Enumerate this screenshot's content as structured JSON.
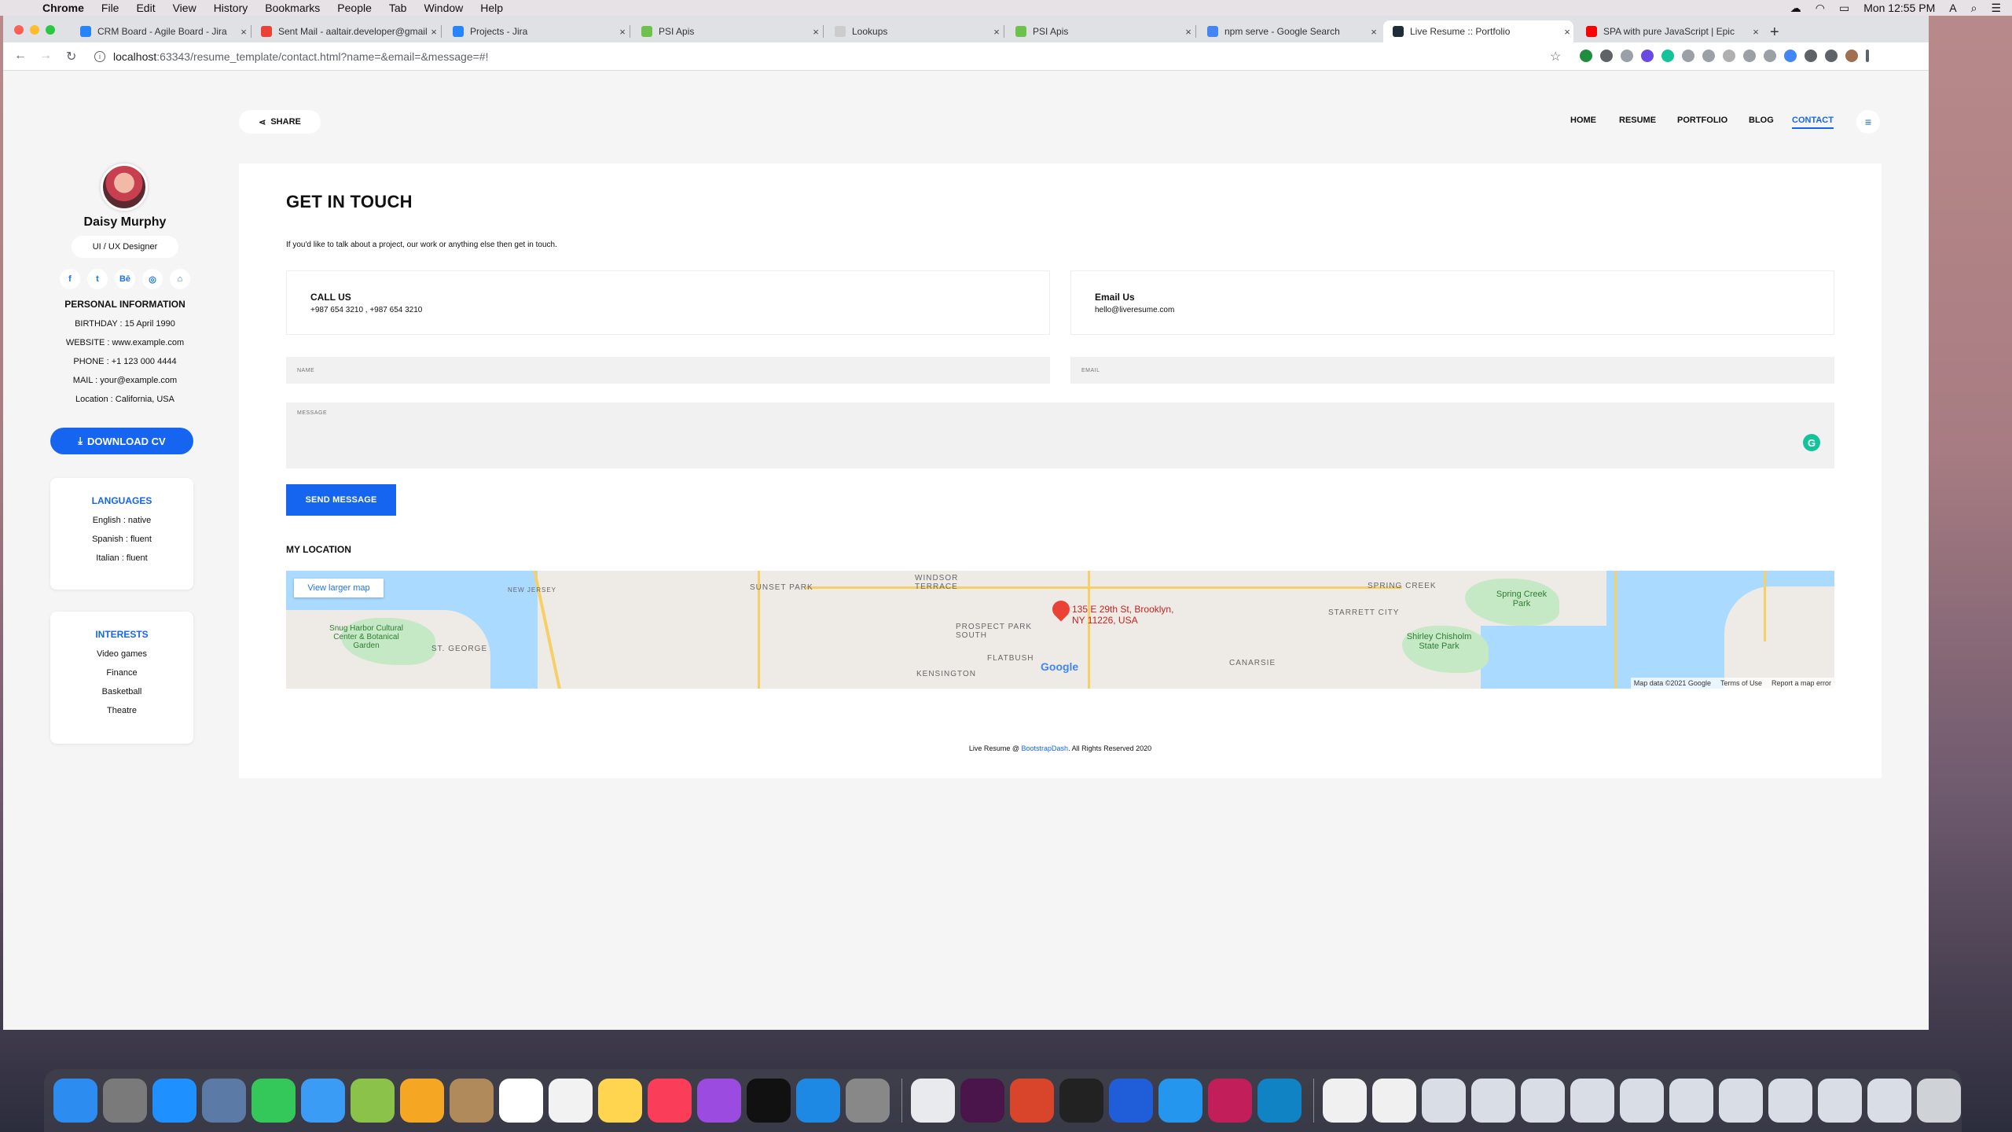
{
  "menubar": {
    "app": "Chrome",
    "items": [
      "File",
      "Edit",
      "View",
      "History",
      "Bookmarks",
      "People",
      "Tab",
      "Window",
      "Help"
    ],
    "clock": "Mon 12:55 PM"
  },
  "tabs": [
    {
      "title": "CRM Board - Agile Board - Jira",
      "color": "#2684ff"
    },
    {
      "title": "Sent Mail - aaltair.developer@gmail.com",
      "color": "#ea4335"
    },
    {
      "title": "Projects - Jira",
      "color": "#2684ff"
    },
    {
      "title": "PSI Apis",
      "color": "#6cc24a"
    },
    {
      "title": "Lookups",
      "color": "#cccccc"
    },
    {
      "title": "PSI Apis",
      "color": "#6cc24a"
    },
    {
      "title": "npm serve - Google Search",
      "color": "#4285f4"
    },
    {
      "title": "Live Resume :: Portfolio",
      "color": "#1f2d3a"
    },
    {
      "title": "SPA with pure JavaScript | Epic",
      "color": "#ff0000"
    }
  ],
  "address": {
    "host": "localhost",
    "path": ":63343/resume_template/contact.html?name=&email=&message=#!"
  },
  "profile": {
    "name": "Daisy Murphy",
    "role": "UI / UX Designer",
    "socials": [
      "f",
      "t",
      "Bē",
      "◎",
      "⌂"
    ],
    "personal_title": "PERSONAL INFORMATION",
    "personal": [
      "BIRTHDAY : 15 April 1990",
      "WEBSITE : www.example.com",
      "PHONE : +1 123 000 4444",
      "MAIL : your@example.com",
      "Location : California, USA"
    ],
    "download": "DOWNLOAD CV"
  },
  "languages": {
    "title": "LANGUAGES",
    "items": [
      "English : native",
      "Spanish : fluent",
      "Italian : fluent"
    ]
  },
  "interests": {
    "title": "INTERESTS",
    "items": [
      "Video games",
      "Finance",
      "Basketball",
      "Theatre"
    ]
  },
  "share": "SHARE",
  "nav": [
    "HOME",
    "RESUME",
    "PORTFOLIO",
    "BLOG",
    "CONTACT"
  ],
  "contact": {
    "title": "GET IN TOUCH",
    "intro": "If you'd like to talk about a project, our work or anything else then get in touch.",
    "call_title": "CALL US",
    "call_value": "+987 654 3210 , +987 654 3210",
    "email_title": "Email Us",
    "email_value": "hello@liveresume.com",
    "name_placeholder": "NAME",
    "email_placeholder": "EMAIL",
    "message_placeholder": "MESSAGE",
    "send": "SEND MESSAGE",
    "location_title": "MY LOCATION"
  },
  "map": {
    "larger": "View larger map",
    "address_line1": "135 E 29th St, Brooklyn,",
    "address_line2": "NY 11226, USA",
    "labels": [
      "SUNSET PARK",
      "NEW JERSEY",
      "ST. GEORGE",
      "Snug Harbor Cultural Center & Botanical Garden",
      "WINDSOR TERRACE",
      "PROSPECT PARK SOUTH",
      "FLATBUSH",
      "KENSINGTON",
      "SPRING CREEK",
      "STARRETT CITY",
      "Spring Creek Park",
      "Shirley Chisholm State Park",
      "CANARSIE"
    ],
    "attrib": [
      "Map data ©2021 Google",
      "Terms of Use",
      "Report a map error"
    ]
  },
  "footer": {
    "pre": "Live Resume @ ",
    "link": "BootstrapDash",
    "post": ". All Rights Reserved 2020"
  }
}
